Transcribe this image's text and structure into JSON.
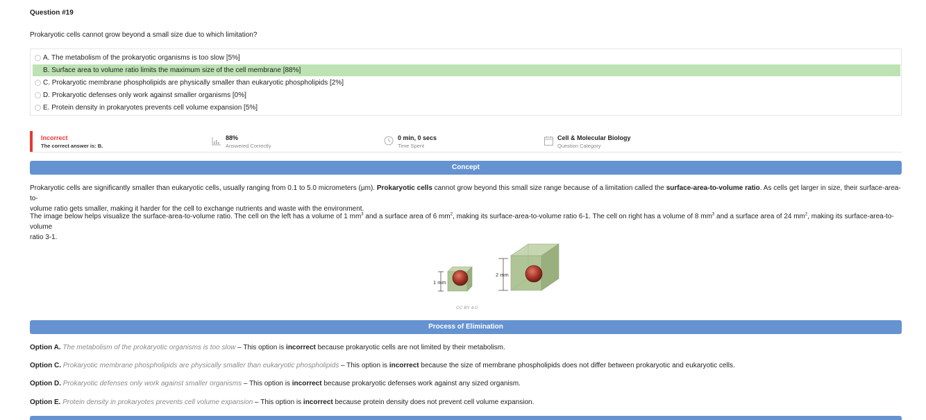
{
  "question": {
    "number": "Question #19",
    "text": "Prokaryotic cells cannot grow beyond a small size due to which limitation?",
    "choices": [
      {
        "label": "A. The metabolism of the prokaryotic organisms is too slow [5%]",
        "correct": false
      },
      {
        "label": "B. Surface area to volume ratio limits the maximum size of the cell membrane [88%]",
        "correct": true
      },
      {
        "label": "C. Prokaryotic membrane phospholipids are physically smaller than eukaryotic phospholipids [2%]",
        "correct": false
      },
      {
        "label": "D. Prokaryotic defenses only work against smaller organisms [0%]",
        "correct": false
      },
      {
        "label": "E. Protein density in prokaryotes prevents cell volume expansion [5%]",
        "correct": false
      }
    ]
  },
  "result": {
    "status": "Incorrect",
    "correct_answer": "The correct answer is: B.",
    "percent": "88%",
    "percent_label": "Answered Correctly",
    "time": "0 min, 0 secs",
    "time_label": "Time Spent",
    "category": "Cell & Molecular Biology",
    "category_label": "Question Category",
    "colors": {
      "incorrect": "#e53935",
      "correct_highlight": "#bde2b4",
      "section_header": "#6592d0"
    }
  },
  "concept": {
    "header": "Concept",
    "p1": {
      "t1": "Prokaryotic cells are significantly smaller than eukaryotic cells, usually ranging from 0.1 to 5.0 micrometers (µm). ",
      "b1": "Prokaryotic cells",
      "t2": " cannot grow beyond this small size range because of a limitation called the ",
      "b2": "surface-area-to-volume ratio",
      "t3": ". As cells get larger in size, their surface-area-to-",
      "line2": "volume ratio gets smaller, making it harder for the cell to exchange nutrients and waste with the environment."
    },
    "p2": {
      "t1": "The image below helps visualize the surface-area-to-volume ratio. The cell on the left has a volume of 1 mm",
      "s1": "3",
      "t2": " and a surface area of 6 mm",
      "s2": "2",
      "t3": ", making its surface-area-to-volume ratio 6-1. The cell on right has a volume of 8 mm",
      "s3": "3",
      "t4": " and a surface area of 24 mm",
      "s4": "2",
      "t5": ", making its surface-area-to-volume",
      "line2": "ratio 3-1."
    },
    "figure": {
      "small_label": "1 mm",
      "large_label": "2 mm",
      "caption": "CC BY 4.0"
    }
  },
  "elimination": {
    "header": "Process of Elimination",
    "options": [
      {
        "lead": "Option A.",
        "quote": "The metabolism of the prokaryotic organisms is too slow",
        "pre": " – This option is ",
        "verdict": "incorrect",
        "post": " because prokaryotic cells are not limited by their metabolism."
      },
      {
        "lead": "Option C.",
        "quote": "Prokaryotic membrane phospholipids are physically smaller than eukaryotic phospholipids ",
        "pre": " – This option is ",
        "verdict": "incorrect",
        "post": " because the size of membrane phospholipids does not differ between prokaryotic and eukaryotic cells."
      },
      {
        "lead": "Option D.",
        "quote": "Prokaryotic defenses only work against smaller organisms",
        "pre": " – This option is ",
        "verdict": "incorrect",
        "post": " because prokaryotic defenses work against any sized organism."
      },
      {
        "lead": "Option E.",
        "quote": "Protein density in prokaryotes prevents cell volume expansion",
        "pre": " – This option is ",
        "verdict": "incorrect",
        "post": " because protein density does not prevent cell volume expansion."
      }
    ]
  }
}
